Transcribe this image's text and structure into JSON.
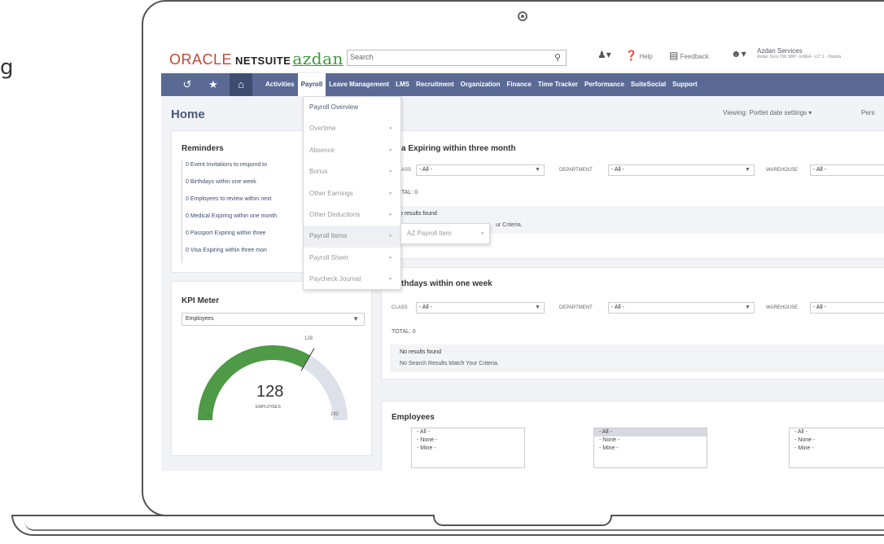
{
  "edge_fragment": "g",
  "brand": {
    "oracle": "ORACLE",
    "netsuite": "NETSUITE",
    "azdan": "azdan"
  },
  "header": {
    "search_placeholder": "Search",
    "help": "Help",
    "feedback": "Feedback",
    "account_name": "Azdan Services",
    "account_sub": "Azdan Svcs OW SBP - EMEA - v17.1 - Standa"
  },
  "nav": {
    "items": [
      "Activities",
      "Payroll",
      "Leave Management",
      "LMS",
      "Recruitment",
      "Organization",
      "Finance",
      "Time Tracker",
      "Performance",
      "SuiteSocial",
      "Support"
    ],
    "active": "Payroll"
  },
  "page": {
    "title": "Home",
    "viewing": "Viewing: Portlet date settings",
    "pers": "Pers"
  },
  "reminders": {
    "title": "Reminders",
    "items": [
      "0 Event Invitations to respond to",
      "0 Birthdays within one week",
      "0 Employees to review within next",
      "0 Medical Expiring within one month",
      "0 Passport Expiring within three",
      "0 Visa Expiring within three mon"
    ]
  },
  "kpi": {
    "title": "KPI Meter",
    "selected": "Employees",
    "value": "128",
    "value_label": "EMPLOYEES",
    "top_label": "128",
    "min": "0",
    "max": "192",
    "fill_fraction": 0.6667
  },
  "visa": {
    "title": "a Expiring within three month",
    "class_label": "ASS",
    "class_value": "- All -",
    "dept_label": "DEPARTMENT",
    "dept_value": "- All -",
    "wh_label": "WAREHOUSE",
    "wh_value": "- All -",
    "total": "TAL: 0",
    "no_results": "o results found",
    "no_match": "ur Criteria."
  },
  "birthdays": {
    "title": "thdays within one week",
    "class_label": "CLASS",
    "class_value": "- All -",
    "dept_label": "DEPARTMENT",
    "dept_value": "- All -",
    "wh_label": "WAREHOUSE",
    "wh_value": "- All -",
    "total": "TOTAL: 0",
    "no_results": "No results found",
    "no_match": "No Search Results Match Your Criteria."
  },
  "employees": {
    "title": "Employees",
    "lists": [
      [
        "- All -",
        "- None -",
        "- Mine -"
      ],
      [
        "- All -",
        "- None -",
        "- Mine -"
      ],
      [
        "- All -",
        "- None -",
        "- Mine -"
      ]
    ]
  },
  "payroll_menu": {
    "items": [
      "Payroll Overview",
      "Overtime",
      "Absence",
      "Bonus",
      "Other Earnings",
      "Other Deductions",
      "Payroll Items",
      "Payroll Sheet",
      "Paycheck Journal"
    ],
    "hovered": "Payroll Items",
    "submenu": [
      "AZ Payroll Item"
    ]
  },
  "colors": {
    "nav_bg": "#5a6a95",
    "gauge_fill": "#4e9a47",
    "gauge_track": "#dde2ea",
    "oracle_red": "#c74634",
    "azdan_green": "#3c9a3c"
  },
  "icons": {
    "recent": "history-icon",
    "favorites": "star-icon",
    "home": "home-icon",
    "search": "search-icon",
    "help": "help-icon",
    "feedback": "feedback-icon",
    "user": "user-icon",
    "app_switch": "person-switch-icon"
  }
}
